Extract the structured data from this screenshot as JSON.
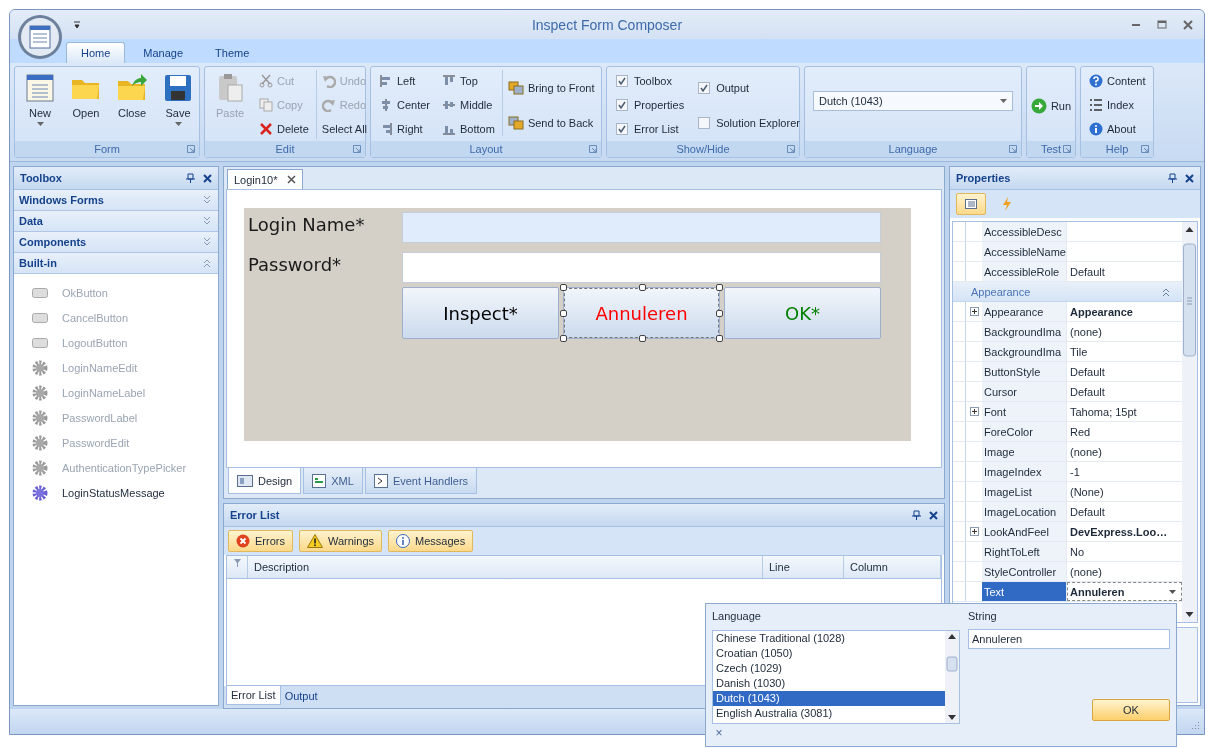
{
  "window": {
    "title": "Inspect Form Composer"
  },
  "ribbon_tabs": [
    {
      "label": "Home",
      "selected": true
    },
    {
      "label": "Manage",
      "selected": false
    },
    {
      "label": "Theme",
      "selected": false
    }
  ],
  "ribbon": {
    "form": {
      "title": "Form",
      "buttons": [
        {
          "label": "New",
          "dropdown": true
        },
        {
          "label": "Open",
          "dropdown": false
        },
        {
          "label": "Close",
          "dropdown": false
        },
        {
          "label": "Save",
          "dropdown": true
        }
      ]
    },
    "edit": {
      "title": "Edit",
      "paste": {
        "label": "Paste",
        "disabled": true
      },
      "commands": [
        {
          "label": "Cut",
          "disabled": true
        },
        {
          "label": "Copy",
          "disabled": true
        },
        {
          "label": "Delete",
          "disabled": false
        },
        {
          "label": "Undo",
          "disabled": true
        },
        {
          "label": "Redo",
          "disabled": true
        },
        {
          "label": "Select All",
          "disabled": false
        }
      ]
    },
    "layout": {
      "title": "Layout",
      "commands": [
        "Left",
        "Center",
        "Right",
        "Top",
        "Middle",
        "Bottom"
      ],
      "order": [
        "Bring to Front",
        "Send to Back"
      ]
    },
    "show_hide": {
      "title": "Show/Hide",
      "options": [
        {
          "label": "Toolbox",
          "checked": true
        },
        {
          "label": "Properties",
          "checked": true
        },
        {
          "label": "Error List",
          "checked": true
        },
        {
          "label": "Output",
          "checked": true
        },
        {
          "label": "Solution Explorer",
          "checked": false
        }
      ]
    },
    "language": {
      "title": "Language",
      "value": "Dutch (1043)"
    },
    "test": {
      "title": "Test",
      "run": "Run"
    },
    "help": {
      "title": "Help",
      "links": [
        "Content",
        "Index",
        "About"
      ]
    }
  },
  "toolbox": {
    "title": "Toolbox",
    "categories": [
      {
        "label": "Windows Forms",
        "expanded": false
      },
      {
        "label": "Data",
        "expanded": false
      },
      {
        "label": "Components",
        "expanded": false
      },
      {
        "label": "Built-in",
        "expanded": true
      }
    ],
    "items": [
      {
        "label": "OkButton",
        "kind": "button",
        "disabled": true
      },
      {
        "label": "CancelButton",
        "kind": "button",
        "disabled": true
      },
      {
        "label": "LogoutButton",
        "kind": "button",
        "disabled": true
      },
      {
        "label": "LoginNameEdit",
        "kind": "component",
        "disabled": true
      },
      {
        "label": "LoginNameLabel",
        "kind": "component",
        "disabled": true
      },
      {
        "label": "PasswordLabel",
        "kind": "component",
        "disabled": true
      },
      {
        "label": "PasswordEdit",
        "kind": "component",
        "disabled": true
      },
      {
        "label": "AuthenticationTypePicker",
        "kind": "component",
        "disabled": true
      },
      {
        "label": "LoginStatusMessage",
        "kind": "component",
        "disabled": false
      }
    ]
  },
  "document_tabs": [
    {
      "label": "Login10*",
      "selected": true
    }
  ],
  "designer": {
    "fields": [
      {
        "label": "Login Name*",
        "focused": true
      },
      {
        "label": "Password*",
        "focused": false
      }
    ],
    "buttons": [
      {
        "label": "Inspect*",
        "color": "#000000",
        "selected": false
      },
      {
        "label": "Annuleren",
        "color": "#ff0000",
        "selected": true
      },
      {
        "label": "OK*",
        "color": "#008000",
        "selected": false
      }
    ]
  },
  "view_tabs": [
    {
      "label": "Design",
      "selected": true
    },
    {
      "label": "XML",
      "selected": false
    },
    {
      "label": "Event Handlers",
      "selected": false
    }
  ],
  "error_list": {
    "title": "Error List",
    "filters": [
      "Errors",
      "Warnings",
      "Messages"
    ],
    "columns": [
      "Description",
      "Line",
      "Column"
    ],
    "tabs": [
      {
        "label": "Error List",
        "selected": true
      },
      {
        "label": "Output",
        "selected": false
      }
    ]
  },
  "properties": {
    "title": "Properties",
    "rows_before": [
      {
        "name": "AccessibleDesc"
      },
      {
        "name": "AccessibleName"
      },
      {
        "name": "AccessibleRole",
        "value": "Default"
      }
    ],
    "category": {
      "label": "Appearance",
      "expanded": true
    },
    "rows": [
      {
        "name": "Appearance",
        "value": "Appearance",
        "expandable": true,
        "modified": true,
        "selected": false
      },
      {
        "name": "BackgroundIma",
        "value": "(none)",
        "expandable": false,
        "modified": false,
        "selected": false
      },
      {
        "name": "BackgroundIma",
        "value": "Tile",
        "expandable": false,
        "modified": false,
        "selected": false
      },
      {
        "name": "ButtonStyle",
        "value": "Default",
        "expandable": false,
        "modified": false,
        "selected": false
      },
      {
        "name": "Cursor",
        "value": "Default",
        "expandable": false,
        "modified": false,
        "selected": false
      },
      {
        "name": "Font",
        "value": "Tahoma; 15pt",
        "expandable": true,
        "modified": false,
        "selected": false
      },
      {
        "name": "ForeColor",
        "value": "Red",
        "expandable": false,
        "modified": false,
        "selected": false
      },
      {
        "name": "Image",
        "value": "(none)",
        "expandable": false,
        "modified": false,
        "selected": false
      },
      {
        "name": "ImageIndex",
        "value": "-1",
        "expandable": false,
        "modified": false,
        "selected": false
      },
      {
        "name": "ImageList",
        "value": "(None)",
        "expandable": false,
        "modified": false,
        "selected": false
      },
      {
        "name": "ImageLocation",
        "value": "Default",
        "expandable": false,
        "modified": false,
        "selected": false
      },
      {
        "name": "LookAndFeel",
        "value": "DevExpress.Loo…",
        "expandable": true,
        "modified": true,
        "selected": false
      },
      {
        "name": "RightToLeft",
        "value": "No",
        "expandable": false,
        "modified": false,
        "selected": false
      },
      {
        "name": "StyleController",
        "value": "(none)",
        "expandable": false,
        "modified": false,
        "selected": false
      },
      {
        "name": "Text",
        "value": "Annuleren",
        "expandable": false,
        "modified": true,
        "selected": true
      }
    ]
  },
  "language_editor": {
    "language_label": "Language",
    "string_label": "String",
    "languages": [
      {
        "label": "Chinese Traditional (1028)",
        "selected": false
      },
      {
        "label": "Croatian (1050)",
        "selected": false
      },
      {
        "label": "Czech (1029)",
        "selected": false
      },
      {
        "label": "Danish (1030)",
        "selected": false
      },
      {
        "label": "Dutch (1043)",
        "selected": true
      },
      {
        "label": "English Australia (3081)",
        "selected": false
      }
    ],
    "string_value": "Annuleren",
    "ok": "OK",
    "close": "×"
  }
}
